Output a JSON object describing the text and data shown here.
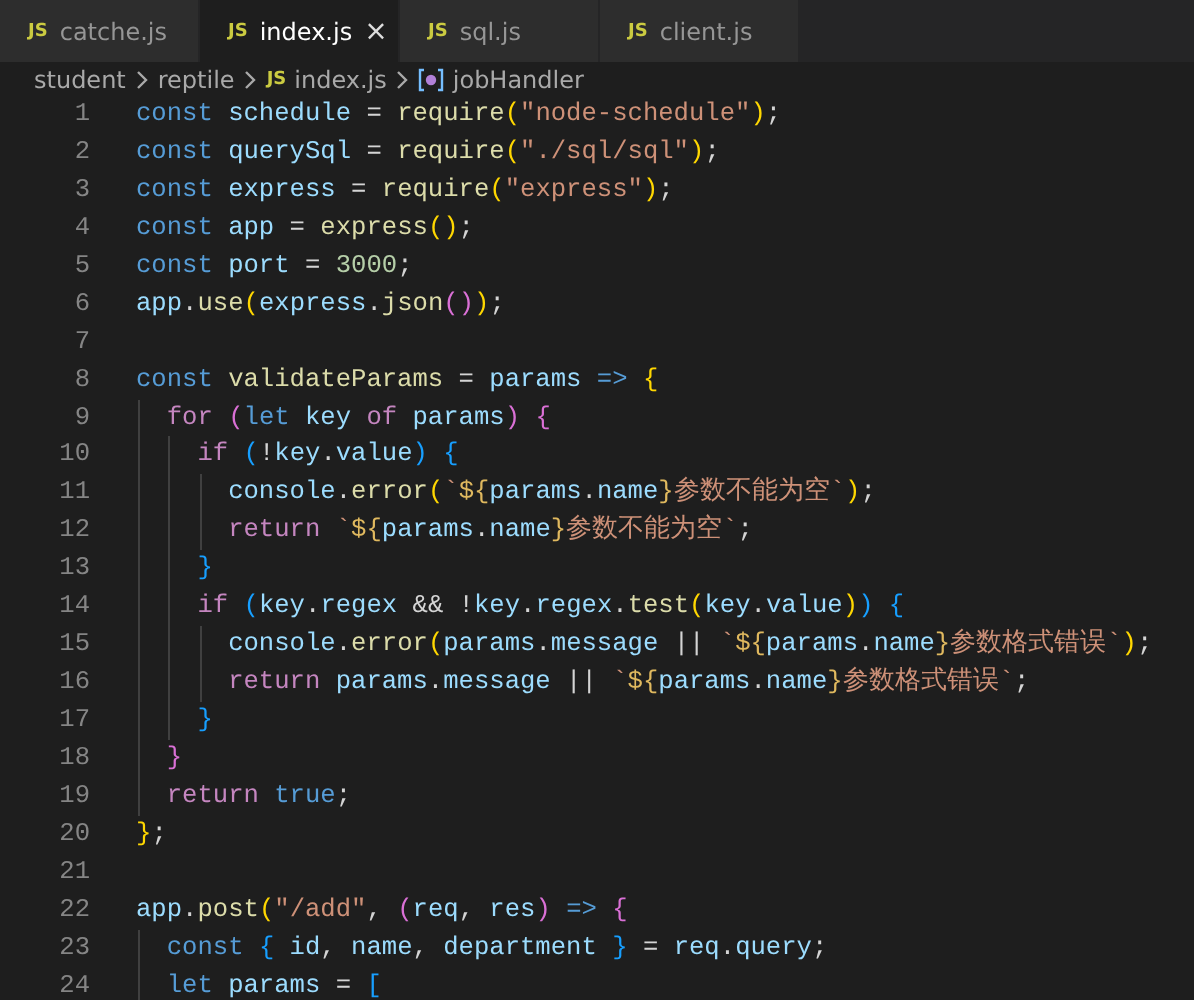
{
  "tabs": [
    {
      "icon": "JS",
      "label": "catche.js",
      "selected": false
    },
    {
      "icon": "JS",
      "label": "index.js",
      "selected": true,
      "close": "×"
    },
    {
      "icon": "JS",
      "label": "sql.js",
      "selected": false
    },
    {
      "icon": "JS",
      "label": "client.js",
      "selected": false
    }
  ],
  "breadcrumb": [
    {
      "kind": "folder",
      "label": "student"
    },
    {
      "kind": "folder",
      "label": "reptile"
    },
    {
      "kind": "file",
      "icon": "JS",
      "label": "index.js"
    },
    {
      "kind": "symbol",
      "label": "jobHandler"
    }
  ],
  "editor": {
    "lines": [
      {
        "number": "1",
        "tokens": [
          {
            "t": "const ",
            "kind": "kw"
          },
          {
            "t": "schedule",
            "kind": "var"
          },
          {
            "t": " = ",
            "kind": "p"
          },
          {
            "t": "require",
            "kind": "fn"
          },
          {
            "t": "(",
            "kind": "b1"
          },
          {
            "t": "\"node-schedule\"",
            "kind": "str"
          },
          {
            "t": ")",
            "kind": "b1"
          },
          {
            "t": ";",
            "kind": "p"
          }
        ]
      },
      {
        "number": "2",
        "tokens": [
          {
            "t": "const ",
            "kind": "kw"
          },
          {
            "t": "querySql",
            "kind": "var"
          },
          {
            "t": " = ",
            "kind": "p"
          },
          {
            "t": "require",
            "kind": "fn"
          },
          {
            "t": "(",
            "kind": "b1"
          },
          {
            "t": "\"./sql/sql\"",
            "kind": "str"
          },
          {
            "t": ")",
            "kind": "b1"
          },
          {
            "t": ";",
            "kind": "p"
          }
        ]
      },
      {
        "number": "3",
        "tokens": [
          {
            "t": "const ",
            "kind": "kw"
          },
          {
            "t": "express",
            "kind": "var"
          },
          {
            "t": " = ",
            "kind": "p"
          },
          {
            "t": "require",
            "kind": "fn"
          },
          {
            "t": "(",
            "kind": "b1"
          },
          {
            "t": "\"express\"",
            "kind": "str"
          },
          {
            "t": ")",
            "kind": "b1"
          },
          {
            "t": ";",
            "kind": "p"
          }
        ]
      },
      {
        "number": "4",
        "tokens": [
          {
            "t": "const ",
            "kind": "kw"
          },
          {
            "t": "app",
            "kind": "var"
          },
          {
            "t": " = ",
            "kind": "p"
          },
          {
            "t": "express",
            "kind": "fn"
          },
          {
            "t": "()",
            "kind": "b1"
          },
          {
            "t": ";",
            "kind": "p"
          }
        ]
      },
      {
        "number": "5",
        "tokens": [
          {
            "t": "const ",
            "kind": "kw"
          },
          {
            "t": "port",
            "kind": "var"
          },
          {
            "t": " = ",
            "kind": "p"
          },
          {
            "t": "3000",
            "kind": "num"
          },
          {
            "t": ";",
            "kind": "p"
          }
        ]
      },
      {
        "number": "6",
        "tokens": [
          {
            "t": "app",
            "kind": "var"
          },
          {
            "t": ".",
            "kind": "p"
          },
          {
            "t": "use",
            "kind": "fn"
          },
          {
            "t": "(",
            "kind": "b1"
          },
          {
            "t": "express",
            "kind": "var"
          },
          {
            "t": ".",
            "kind": "p"
          },
          {
            "t": "json",
            "kind": "fn"
          },
          {
            "t": "()",
            "kind": "b2"
          },
          {
            "t": ")",
            "kind": "b1"
          },
          {
            "t": ";",
            "kind": "p"
          }
        ]
      },
      {
        "number": "7"
      },
      {
        "number": "8",
        "tokens": [
          {
            "t": "const ",
            "kind": "kw"
          },
          {
            "t": "validateParams",
            "kind": "fn"
          },
          {
            "t": " = ",
            "kind": "p"
          },
          {
            "t": "params ",
            "kind": "var"
          },
          {
            "t": "=> ",
            "kind": "kw"
          },
          {
            "t": "{",
            "kind": "b1"
          }
        ]
      },
      {
        "number": "9",
        "tokens": [
          {
            "t": "  for ",
            "kind": "ctl"
          },
          {
            "t": "(",
            "kind": "b2"
          },
          {
            "t": "let ",
            "kind": "kw"
          },
          {
            "t": "key ",
            "kind": "var"
          },
          {
            "t": "of ",
            "kind": "ctl"
          },
          {
            "t": "params",
            "kind": "var"
          },
          {
            "t": ") ",
            "kind": "b2"
          },
          {
            "t": "{",
            "kind": "b2"
          }
        ]
      },
      {
        "number": "10",
        "tokens": [
          {
            "t": "    if ",
            "kind": "ctl"
          },
          {
            "t": "(",
            "kind": "b3"
          },
          {
            "t": "!",
            "kind": "p"
          },
          {
            "t": "key",
            "kind": "var"
          },
          {
            "t": ".",
            "kind": "p"
          },
          {
            "t": "value",
            "kind": "var"
          },
          {
            "t": ") ",
            "kind": "b3"
          },
          {
            "t": "{",
            "kind": "b3"
          }
        ]
      },
      {
        "number": "11",
        "tokens": [
          {
            "t": "      console",
            "kind": "var"
          },
          {
            "t": ".",
            "kind": "p"
          },
          {
            "t": "error",
            "kind": "fn"
          },
          {
            "t": "(",
            "kind": "b1"
          },
          {
            "t": "`",
            "kind": "str"
          },
          {
            "t": "${",
            "kind": "tpl"
          },
          {
            "t": "params",
            "kind": "var"
          },
          {
            "t": ".",
            "kind": "p"
          },
          {
            "t": "name",
            "kind": "var"
          },
          {
            "t": "}",
            "kind": "tpl"
          },
          {
            "t": "参数不能为空`",
            "kind": "str"
          },
          {
            "t": ")",
            "kind": "b1"
          },
          {
            "t": ";",
            "kind": "p"
          }
        ]
      },
      {
        "number": "12",
        "tokens": [
          {
            "t": "      return ",
            "kind": "ctl"
          },
          {
            "t": "`",
            "kind": "str"
          },
          {
            "t": "${",
            "kind": "tpl"
          },
          {
            "t": "params",
            "kind": "var"
          },
          {
            "t": ".",
            "kind": "p"
          },
          {
            "t": "name",
            "kind": "var"
          },
          {
            "t": "}",
            "kind": "tpl"
          },
          {
            "t": "参数不能为空`",
            "kind": "str"
          },
          {
            "t": ";",
            "kind": "p"
          }
        ]
      },
      {
        "number": "13",
        "tokens": [
          {
            "t": "    }",
            "kind": "b3"
          }
        ]
      },
      {
        "number": "14",
        "tokens": [
          {
            "t": "    if ",
            "kind": "ctl"
          },
          {
            "t": "(",
            "kind": "b3"
          },
          {
            "t": "key",
            "kind": "var"
          },
          {
            "t": ".",
            "kind": "p"
          },
          {
            "t": "regex",
            "kind": "var"
          },
          {
            "t": " && !",
            "kind": "p"
          },
          {
            "t": "key",
            "kind": "var"
          },
          {
            "t": ".",
            "kind": "p"
          },
          {
            "t": "regex",
            "kind": "var"
          },
          {
            "t": ".",
            "kind": "p"
          },
          {
            "t": "test",
            "kind": "fn"
          },
          {
            "t": "(",
            "kind": "b1"
          },
          {
            "t": "key",
            "kind": "var"
          },
          {
            "t": ".",
            "kind": "p"
          },
          {
            "t": "value",
            "kind": "var"
          },
          {
            "t": ")",
            "kind": "b1"
          },
          {
            "t": ") ",
            "kind": "b3"
          },
          {
            "t": "{",
            "kind": "b3"
          }
        ]
      },
      {
        "number": "15",
        "tokens": [
          {
            "t": "      console",
            "kind": "var"
          },
          {
            "t": ".",
            "kind": "p"
          },
          {
            "t": "error",
            "kind": "fn"
          },
          {
            "t": "(",
            "kind": "b1"
          },
          {
            "t": "params",
            "kind": "var"
          },
          {
            "t": ".",
            "kind": "p"
          },
          {
            "t": "message",
            "kind": "var"
          },
          {
            "t": " || ",
            "kind": "p"
          },
          {
            "t": "`",
            "kind": "str"
          },
          {
            "t": "${",
            "kind": "tpl"
          },
          {
            "t": "params",
            "kind": "var"
          },
          {
            "t": ".",
            "kind": "p"
          },
          {
            "t": "name",
            "kind": "var"
          },
          {
            "t": "}",
            "kind": "tpl"
          },
          {
            "t": "参数格式错误`",
            "kind": "str"
          },
          {
            "t": ")",
            "kind": "b1"
          },
          {
            "t": ";",
            "kind": "p"
          }
        ]
      },
      {
        "number": "16",
        "tokens": [
          {
            "t": "      return ",
            "kind": "ctl"
          },
          {
            "t": "params",
            "kind": "var"
          },
          {
            "t": ".",
            "kind": "p"
          },
          {
            "t": "message",
            "kind": "var"
          },
          {
            "t": " || ",
            "kind": "p"
          },
          {
            "t": "`",
            "kind": "str"
          },
          {
            "t": "${",
            "kind": "tpl"
          },
          {
            "t": "params",
            "kind": "var"
          },
          {
            "t": ".",
            "kind": "p"
          },
          {
            "t": "name",
            "kind": "var"
          },
          {
            "t": "}",
            "kind": "tpl"
          },
          {
            "t": "参数格式错误`",
            "kind": "str"
          },
          {
            "t": ";",
            "kind": "p"
          }
        ]
      },
      {
        "number": "17",
        "tokens": [
          {
            "t": "    }",
            "kind": "b3"
          }
        ]
      },
      {
        "number": "18",
        "tokens": [
          {
            "t": "  }",
            "kind": "b2"
          }
        ]
      },
      {
        "number": "19",
        "tokens": [
          {
            "t": "  return ",
            "kind": "ctl"
          },
          {
            "t": "true",
            "kind": "kw"
          },
          {
            "t": ";",
            "kind": "p"
          }
        ]
      },
      {
        "number": "20",
        "tokens": [
          {
            "t": "}",
            "kind": "b1"
          },
          {
            "t": ";",
            "kind": "p"
          }
        ]
      },
      {
        "number": "21"
      },
      {
        "number": "22",
        "tokens": [
          {
            "t": "app",
            "kind": "var"
          },
          {
            "t": ".",
            "kind": "p"
          },
          {
            "t": "post",
            "kind": "fn"
          },
          {
            "t": "(",
            "kind": "b1"
          },
          {
            "t": "\"/add\"",
            "kind": "str"
          },
          {
            "t": ", ",
            "kind": "p"
          },
          {
            "t": "(",
            "kind": "b2"
          },
          {
            "t": "req",
            "kind": "var"
          },
          {
            "t": ", ",
            "kind": "p"
          },
          {
            "t": "res",
            "kind": "var"
          },
          {
            "t": ") ",
            "kind": "b2"
          },
          {
            "t": "=> ",
            "kind": "kw"
          },
          {
            "t": "{",
            "kind": "b2"
          }
        ]
      },
      {
        "number": "23",
        "tokens": [
          {
            "t": "  const ",
            "kind": "kw"
          },
          {
            "t": "{",
            "kind": "b3"
          },
          {
            "t": " id",
            "kind": "var"
          },
          {
            "t": ", ",
            "kind": "p"
          },
          {
            "t": "name",
            "kind": "var"
          },
          {
            "t": ", ",
            "kind": "p"
          },
          {
            "t": "department ",
            "kind": "var"
          },
          {
            "t": "}",
            "kind": "b3"
          },
          {
            "t": " = ",
            "kind": "p"
          },
          {
            "t": "req",
            "kind": "var"
          },
          {
            "t": ".",
            "kind": "p"
          },
          {
            "t": "query",
            "kind": "var"
          },
          {
            "t": ";",
            "kind": "p"
          }
        ]
      },
      {
        "number": "24",
        "tokens": [
          {
            "t": "  let ",
            "kind": "kw"
          },
          {
            "t": "params",
            "kind": "var"
          },
          {
            "t": " = ",
            "kind": "p"
          },
          {
            "t": "[",
            "kind": "b3"
          }
        ]
      }
    ]
  }
}
